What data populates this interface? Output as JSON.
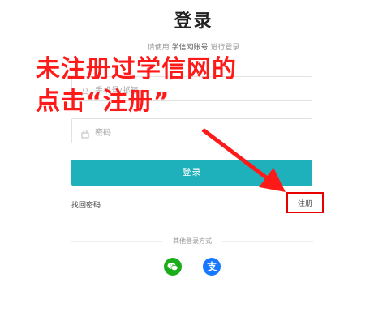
{
  "title": "登录",
  "subtitle": {
    "prefix": "请使用",
    "highlight": "学信网账号",
    "suffix": "进行登录"
  },
  "phone_field": {
    "placeholder": "手机号/邮箱"
  },
  "password_field": {
    "placeholder": "密码"
  },
  "login_button": "登录",
  "forgot_link": "找回密码",
  "register_link": "注册",
  "other_login": "其他登录方式",
  "annotation": {
    "line1": "未注册过学信网的",
    "line2": "点击“注册”",
    "color": "#ff1a1a"
  },
  "colors": {
    "accent": "#1fb1bb",
    "highlight_box": "#e60000",
    "wechat": "#1aad19",
    "alipay": "#1677ff"
  },
  "icons": [
    "user-icon",
    "lock-icon",
    "wechat-icon",
    "alipay-icon"
  ]
}
